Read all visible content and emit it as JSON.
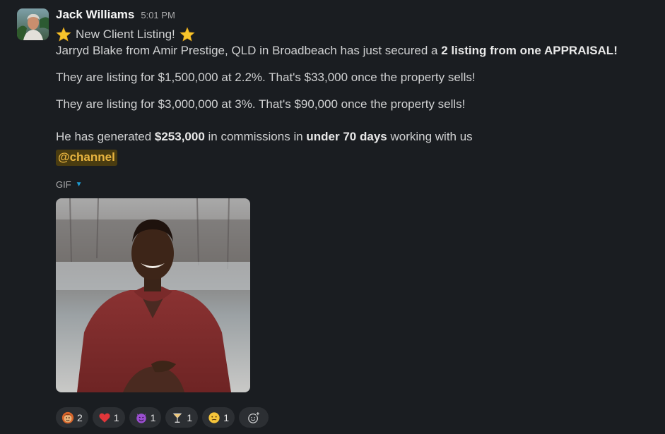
{
  "message": {
    "author": "Jack Williams",
    "timestamp": "5:01 PM",
    "headline": "New Client Listing!",
    "line1_pre": "Jarryd Blake from Amir Prestige, QLD in Broadbeach has just secured a ",
    "line1_bold": "2 listing from one APPRAISAL!",
    "line2": "They are listing for $1,500,000 at 2.2%. That's $33,000 once the property sells!",
    "line3": "They are listing for $3,000,000 at 3%. That's $90,000 once the property sells!",
    "line4_pre": "He has generated ",
    "line4_amount": "$253,000",
    "line4_mid": " in commissions in ",
    "line4_days": "under 70 days",
    "line4_post": " working with us",
    "mention": "@channel"
  },
  "attachment": {
    "label": "GIF"
  },
  "reactions": [
    {
      "emoji": "custom-face-icon",
      "count": "2"
    },
    {
      "emoji": "red-heart-icon",
      "count": "1"
    },
    {
      "emoji": "smiling-devil-icon",
      "count": "1"
    },
    {
      "emoji": "cocktail-glass-icon",
      "count": "1"
    },
    {
      "emoji": "confused-face-icon",
      "count": "1"
    }
  ],
  "colors": {
    "background": "#1a1d21",
    "mention_bg": "#4a3c10",
    "mention_text": "#e8b440",
    "link_blue": "#1d9bd1"
  }
}
